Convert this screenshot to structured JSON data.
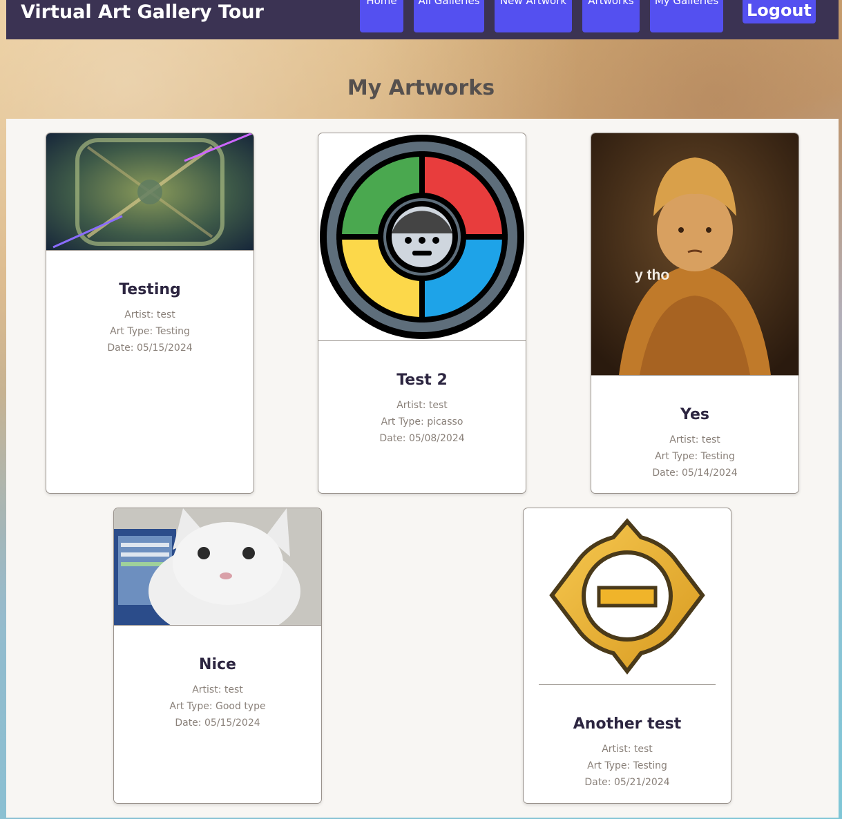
{
  "header": {
    "brand": "Virtual Art Gallery Tour",
    "nav": [
      "Home",
      "All Galleries",
      "New Artwork",
      "Artworks",
      "My Galleries"
    ],
    "logout": "Logout"
  },
  "page": {
    "title": "My Artworks"
  },
  "artworks": [
    {
      "title": "Testing",
      "artist": "Artist: test",
      "type": "Art Type: Testing",
      "date": "Date: 05/15/2024",
      "image": "game-map-image"
    },
    {
      "title": "Test 2",
      "artist": "Artist: test",
      "type": "Art Type: picasso",
      "date": "Date: 05/08/2024",
      "image": "simon-game-icon"
    },
    {
      "title": "Yes",
      "artist": "Artist: test",
      "type": "Art Type: Testing",
      "date": "Date: 05/14/2024",
      "image": "portrait-meme-image",
      "caption": "y tho"
    },
    {
      "title": "Nice",
      "artist": "Artist: test",
      "type": "Art Type: Good type",
      "date": "Date: 05/15/2024",
      "image": "crying-cat-image"
    },
    {
      "title": "Another test",
      "artist": "Artist: test",
      "type": "Art Type: Testing",
      "date": "Date: 05/21/2024",
      "image": "gold-badge-icon"
    }
  ],
  "colors": {
    "nav_bg": "#3b3353",
    "button": "#5450f0",
    "title": "#55504e"
  }
}
